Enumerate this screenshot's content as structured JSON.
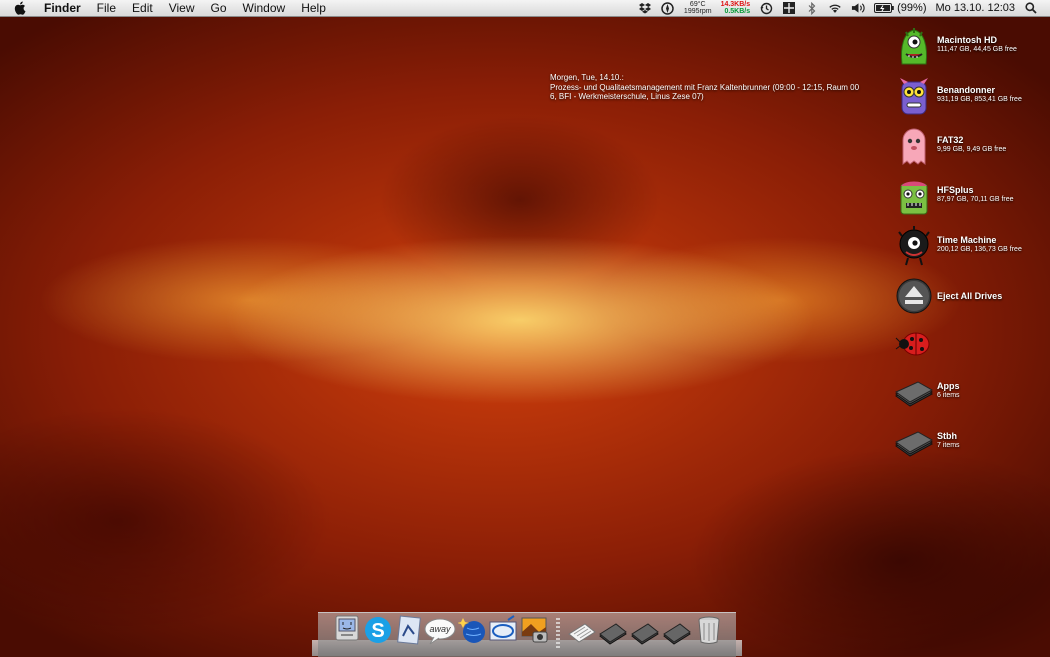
{
  "menubar": {
    "app_name": "Finder",
    "menus": [
      "File",
      "Edit",
      "View",
      "Go",
      "Window",
      "Help"
    ],
    "status": {
      "temperature": "69°C",
      "fan": "1995rpm",
      "net_up": "14.3KB/s",
      "net_down": "0.5KB/s",
      "battery": "(99%)",
      "clock": "Mo 13.10.  12:03"
    },
    "icons": [
      "dropbox-icon",
      "compass-icon",
      "time-machine-icon",
      "puzzle-icon",
      "bluetooth-icon",
      "wifi-icon",
      "volume-icon",
      "battery-icon",
      "spotlight-icon"
    ]
  },
  "calendar": {
    "line1": "Morgen, Tue, 14.10.:",
    "line2": "Prozess- und Qualitaetsmanagement mit Franz Kaltenbrunner (09:00 - 12:15, Raum 00",
    "line3": "6, BFI - Werkmeisterschule, Linus Zese 07)"
  },
  "desktop": {
    "items": [
      {
        "name": "Macintosh HD",
        "info": "111,47 GB, 44,45 GB free",
        "icon": "green-monster-drive-icon"
      },
      {
        "name": "Benandonner",
        "info": "931,19 GB, 853,41 GB free",
        "icon": "purple-monster-drive-icon"
      },
      {
        "name": "FAT32",
        "info": "9,99 GB, 9,49 GB free",
        "icon": "pink-ghost-drive-icon"
      },
      {
        "name": "HFSplus",
        "info": "87,97 GB, 70,11 GB free",
        "icon": "green-box-monster-drive-icon"
      },
      {
        "name": "Time Machine",
        "info": "200,12 GB, 136,73 GB free",
        "icon": "black-monster-drive-icon"
      },
      {
        "name": "Eject All Drives",
        "info": "",
        "icon": "eject-icon"
      },
      {
        "name": "",
        "info": "",
        "icon": "ladybug-icon"
      },
      {
        "name": "Apps",
        "info": "6 items",
        "icon": "folder-stack-icon"
      },
      {
        "name": "Stbh",
        "info": "7 items",
        "icon": "folder-stack-icon"
      }
    ]
  },
  "dock": {
    "items": [
      "finder-icon",
      "skype-icon",
      "preview-icon",
      "adium-icon",
      "browser-globe-icon",
      "mail-icon",
      "iphoto-icon",
      "documents-icon",
      "stack-icon",
      "stack-icon",
      "stack-icon",
      "trash-icon"
    ]
  }
}
